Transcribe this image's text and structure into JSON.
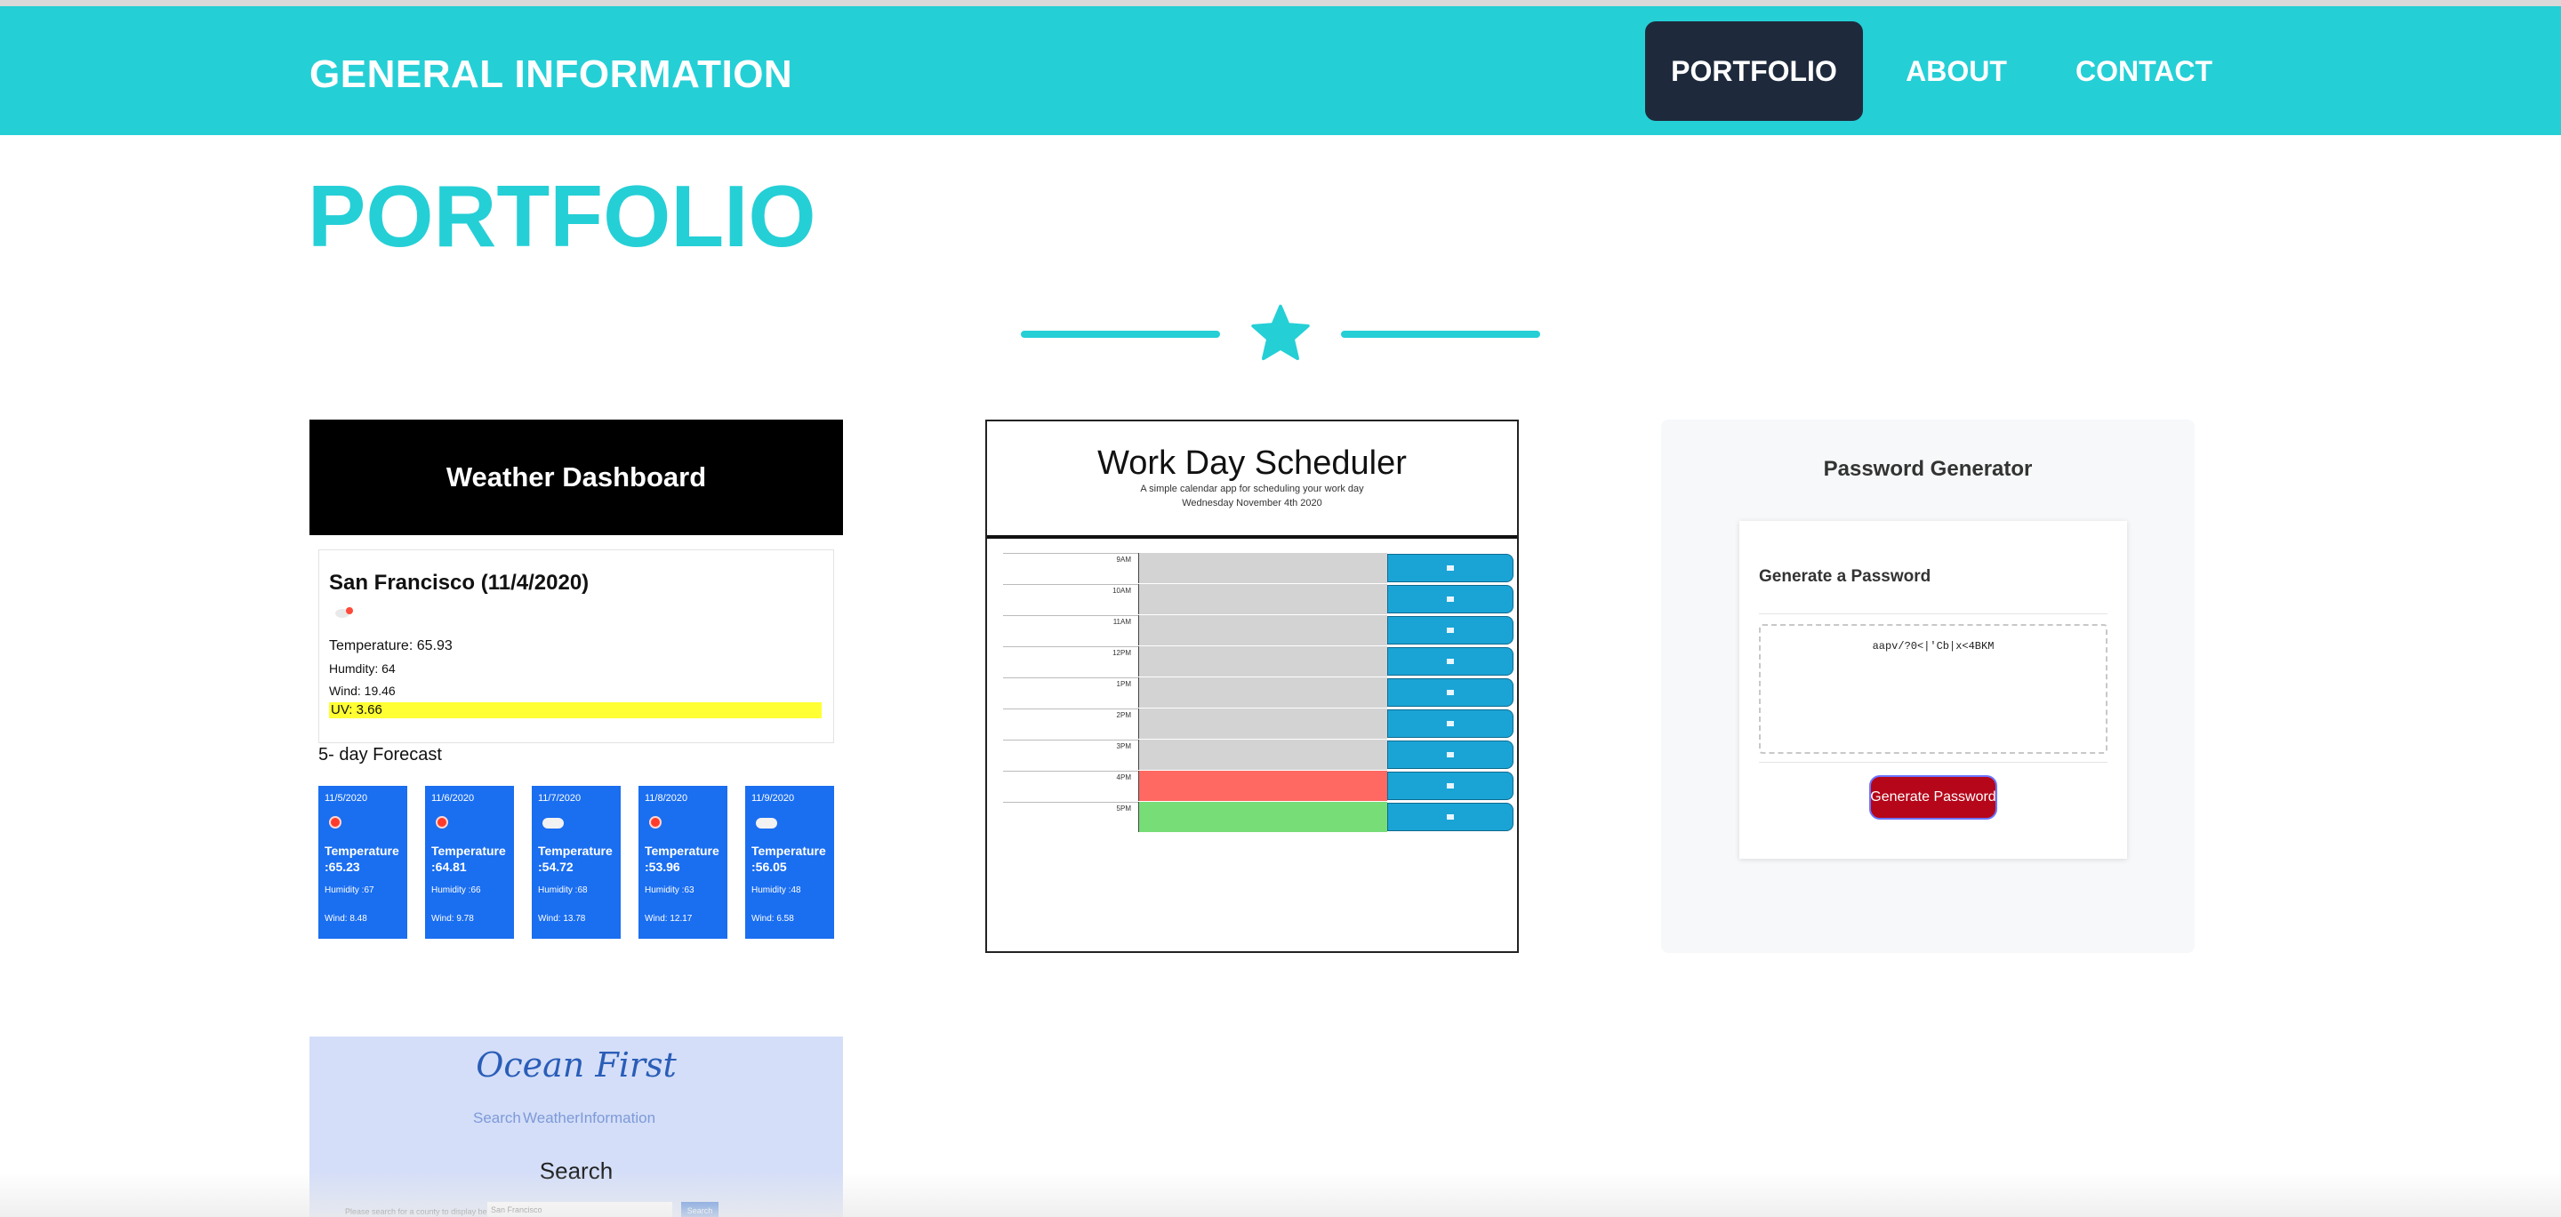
{
  "nav": {
    "brand": "GENERAL INFORMATION",
    "items": [
      {
        "label": "PORTFOLIO",
        "active": true
      },
      {
        "label": "ABOUT",
        "active": false
      },
      {
        "label": "CONTACT",
        "active": false
      }
    ]
  },
  "page": {
    "heading": "PORTFOLIO",
    "divider_icon": "star-icon",
    "accent_color": "#25cfd6",
    "nav_active_color": "#1e2a3c"
  },
  "projects": {
    "weather": {
      "title": "Weather Dashboard",
      "city": "San Francisco (11/4/2020)",
      "temperature": "Temperature: 65.93",
      "humidity": "Humdity: 64",
      "wind": "Wind: 19.46",
      "uv": "UV: 3.66",
      "forecast_title": "5- day Forecast",
      "forecast": [
        {
          "date": "11/5/2020",
          "temp": "Temperature :65.23",
          "humidity": "Humidity :67",
          "wind": "Wind: 8.48",
          "icon": "sun-icon"
        },
        {
          "date": "11/6/2020",
          "temp": "Temperature :64.81",
          "humidity": "Humidity :66",
          "wind": "Wind: 9.78",
          "icon": "sun-icon"
        },
        {
          "date": "11/7/2020",
          "temp": "Temperature :54.72",
          "humidity": "Humidity :68",
          "wind": "Wind: 13.78",
          "icon": "cloud-icon"
        },
        {
          "date": "11/8/2020",
          "temp": "Temperature :53.96",
          "humidity": "Humidity :63",
          "wind": "Wind: 12.17",
          "icon": "sun-icon"
        },
        {
          "date": "11/9/2020",
          "temp": "Temperature :56.05",
          "humidity": "Humidity :48",
          "wind": "Wind: 6.58",
          "icon": "cloud-icon"
        }
      ]
    },
    "scheduler": {
      "title": "Work Day Scheduler",
      "subtitle": "A simple calendar app for scheduling your work day",
      "date": "Wednesday November 4th 2020",
      "hours": [
        {
          "label": "9AM",
          "state": "past"
        },
        {
          "label": "10AM",
          "state": "past"
        },
        {
          "label": "11AM",
          "state": "past"
        },
        {
          "label": "12PM",
          "state": "past"
        },
        {
          "label": "1PM",
          "state": "past"
        },
        {
          "label": "2PM",
          "state": "past"
        },
        {
          "label": "3PM",
          "state": "past"
        },
        {
          "label": "4PM",
          "state": "present"
        },
        {
          "label": "5PM",
          "state": "future"
        }
      ],
      "colors": {
        "past": "#d3d3d3",
        "present": "#ff6961",
        "future": "#77dd77"
      }
    },
    "password": {
      "title": "Password Generator",
      "subtitle": "Generate a Password",
      "value": "aapv/?0<|'Cb|x<4BKM",
      "button": "Generate Password"
    },
    "ocean": {
      "title": "Ocean First",
      "nav": [
        "Search",
        "Weather",
        "Information"
      ],
      "search_heading": "Search",
      "prompt": "Please search for a county to display beaches",
      "input_value": "San Francisco",
      "button": "Search"
    }
  }
}
